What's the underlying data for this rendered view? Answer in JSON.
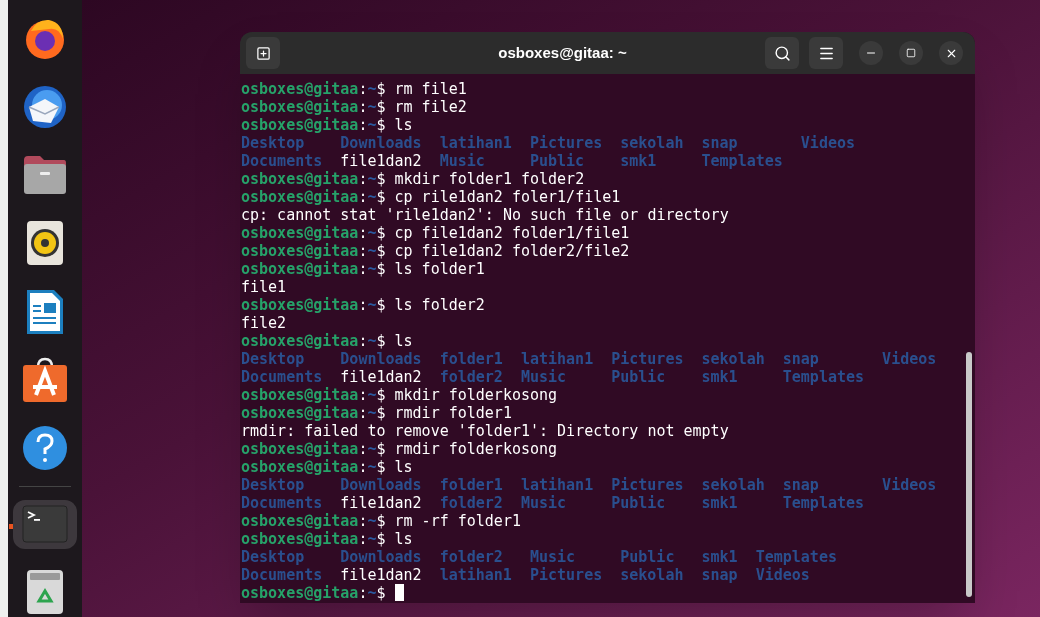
{
  "dock": {
    "items": [
      {
        "kind": "browser",
        "running": false
      },
      {
        "kind": "mail",
        "running": false
      },
      {
        "kind": "files",
        "running": false
      },
      {
        "kind": "music",
        "running": false
      },
      {
        "kind": "writer",
        "running": false
      },
      {
        "kind": "store",
        "running": false
      },
      {
        "kind": "help",
        "running": false
      },
      {
        "kind": "separator"
      },
      {
        "kind": "terminal",
        "running": true
      },
      {
        "kind": "trash",
        "running": false
      }
    ]
  },
  "window": {
    "title": "osboxes@gitaa: ~"
  },
  "terminal": {
    "lines": [
      {
        "kind": "prompt",
        "user": "osboxes@gitaa",
        "colon": ":",
        "path": "~",
        "sign": "$",
        "command": "rm file1"
      },
      {
        "kind": "prompt",
        "user": "osboxes@gitaa",
        "colon": ":",
        "path": "~",
        "sign": "$",
        "command": "rm file2"
      },
      {
        "kind": "prompt",
        "user": "osboxes@gitaa",
        "colon": ":",
        "path": "~",
        "sign": "$",
        "command": "ls"
      },
      {
        "kind": "listing",
        "rows": [
          [
            {
              "name": "Desktop",
              "kind": "dir"
            },
            {
              "name": "Downloads",
              "kind": "dir"
            },
            {
              "name": "latihan1",
              "kind": "dir"
            },
            {
              "name": "Pictures",
              "kind": "dir"
            },
            {
              "name": "sekolah",
              "kind": "dir"
            },
            {
              "name": "snap",
              "kind": "dir"
            },
            {
              "name": "Videos",
              "kind": "dir"
            }
          ],
          [
            {
              "name": "Documents",
              "kind": "dir"
            },
            {
              "name": "file1dan2",
              "kind": "file"
            },
            {
              "name": "Music",
              "kind": "dir"
            },
            {
              "name": "Public",
              "kind": "dir"
            },
            {
              "name": "smk1",
              "kind": "dir"
            },
            {
              "name": "Templates",
              "kind": "dir"
            }
          ]
        ]
      },
      {
        "kind": "prompt",
        "user": "osboxes@gitaa",
        "colon": ":",
        "path": "~",
        "sign": "$",
        "command": "mkdir folder1 folder2"
      },
      {
        "kind": "prompt",
        "user": "osboxes@gitaa",
        "colon": ":",
        "path": "~",
        "sign": "$",
        "command": "cp rile1dan2 foler1/file1"
      },
      {
        "kind": "output",
        "text": "cp: cannot stat 'rile1dan2': No such file or directory"
      },
      {
        "kind": "prompt",
        "user": "osboxes@gitaa",
        "colon": ":",
        "path": "~",
        "sign": "$",
        "command": "cp file1dan2 folder1/file1"
      },
      {
        "kind": "prompt",
        "user": "osboxes@gitaa",
        "colon": ":",
        "path": "~",
        "sign": "$",
        "command": "cp file1dan2 folder2/file2"
      },
      {
        "kind": "prompt",
        "user": "osboxes@gitaa",
        "colon": ":",
        "path": "~",
        "sign": "$",
        "command": "ls folder1"
      },
      {
        "kind": "output",
        "text": "file1"
      },
      {
        "kind": "prompt",
        "user": "osboxes@gitaa",
        "colon": ":",
        "path": "~",
        "sign": "$",
        "command": "ls folder2"
      },
      {
        "kind": "output",
        "text": "file2"
      },
      {
        "kind": "prompt",
        "user": "osboxes@gitaa",
        "colon": ":",
        "path": "~",
        "sign": "$",
        "command": "ls"
      },
      {
        "kind": "listing",
        "rows": [
          [
            {
              "name": "Desktop",
              "kind": "dir"
            },
            {
              "name": "Downloads",
              "kind": "dir"
            },
            {
              "name": "folder1",
              "kind": "dir"
            },
            {
              "name": "latihan1",
              "kind": "dir"
            },
            {
              "name": "Pictures",
              "kind": "dir"
            },
            {
              "name": "sekolah",
              "kind": "dir"
            },
            {
              "name": "snap",
              "kind": "dir"
            },
            {
              "name": "Videos",
              "kind": "dir"
            }
          ],
          [
            {
              "name": "Documents",
              "kind": "dir"
            },
            {
              "name": "file1dan2",
              "kind": "file"
            },
            {
              "name": "folder2",
              "kind": "dir"
            },
            {
              "name": "Music",
              "kind": "dir"
            },
            {
              "name": "Public",
              "kind": "dir"
            },
            {
              "name": "smk1",
              "kind": "dir"
            },
            {
              "name": "Templates",
              "kind": "dir"
            }
          ]
        ]
      },
      {
        "kind": "prompt",
        "user": "osboxes@gitaa",
        "colon": ":",
        "path": "~",
        "sign": "$",
        "command": "mkdir folderkosong"
      },
      {
        "kind": "prompt",
        "user": "osboxes@gitaa",
        "colon": ":",
        "path": "~",
        "sign": "$",
        "command": "rmdir folder1"
      },
      {
        "kind": "output",
        "text": "rmdir: failed to remove 'folder1': Directory not empty"
      },
      {
        "kind": "prompt",
        "user": "osboxes@gitaa",
        "colon": ":",
        "path": "~",
        "sign": "$",
        "command": "rmdir folderkosong"
      },
      {
        "kind": "prompt",
        "user": "osboxes@gitaa",
        "colon": ":",
        "path": "~",
        "sign": "$",
        "command": "ls"
      },
      {
        "kind": "listing",
        "rows": [
          [
            {
              "name": "Desktop",
              "kind": "dir"
            },
            {
              "name": "Downloads",
              "kind": "dir"
            },
            {
              "name": "folder1",
              "kind": "dir"
            },
            {
              "name": "latihan1",
              "kind": "dir"
            },
            {
              "name": "Pictures",
              "kind": "dir"
            },
            {
              "name": "sekolah",
              "kind": "dir"
            },
            {
              "name": "snap",
              "kind": "dir"
            },
            {
              "name": "Videos",
              "kind": "dir"
            }
          ],
          [
            {
              "name": "Documents",
              "kind": "dir"
            },
            {
              "name": "file1dan2",
              "kind": "file"
            },
            {
              "name": "folder2",
              "kind": "dir"
            },
            {
              "name": "Music",
              "kind": "dir"
            },
            {
              "name": "Public",
              "kind": "dir"
            },
            {
              "name": "smk1",
              "kind": "dir"
            },
            {
              "name": "Templates",
              "kind": "dir"
            }
          ]
        ]
      },
      {
        "kind": "prompt",
        "user": "osboxes@gitaa",
        "colon": ":",
        "path": "~",
        "sign": "$",
        "command": "rm -rf folder1"
      },
      {
        "kind": "prompt",
        "user": "osboxes@gitaa",
        "colon": ":",
        "path": "~",
        "sign": "$",
        "command": "ls"
      },
      {
        "kind": "listing",
        "rows": [
          [
            {
              "name": "Desktop",
              "kind": "dir"
            },
            {
              "name": "Downloads",
              "kind": "dir"
            },
            {
              "name": "folder2",
              "kind": "dir"
            },
            {
              "name": "Music",
              "kind": "dir"
            },
            {
              "name": "Public",
              "kind": "dir"
            },
            {
              "name": "smk1",
              "kind": "dir"
            },
            {
              "name": "Templates",
              "kind": "dir"
            }
          ],
          [
            {
              "name": "Documents",
              "kind": "dir"
            },
            {
              "name": "file1dan2",
              "kind": "file"
            },
            {
              "name": "latihan1",
              "kind": "dir"
            },
            {
              "name": "Pictures",
              "kind": "dir"
            },
            {
              "name": "sekolah",
              "kind": "dir"
            },
            {
              "name": "snap",
              "kind": "dir"
            },
            {
              "name": "Videos",
              "kind": "dir"
            }
          ]
        ]
      },
      {
        "kind": "prompt",
        "user": "osboxes@gitaa",
        "colon": ":",
        "path": "~",
        "sign": "$",
        "cursor": true
      }
    ]
  }
}
